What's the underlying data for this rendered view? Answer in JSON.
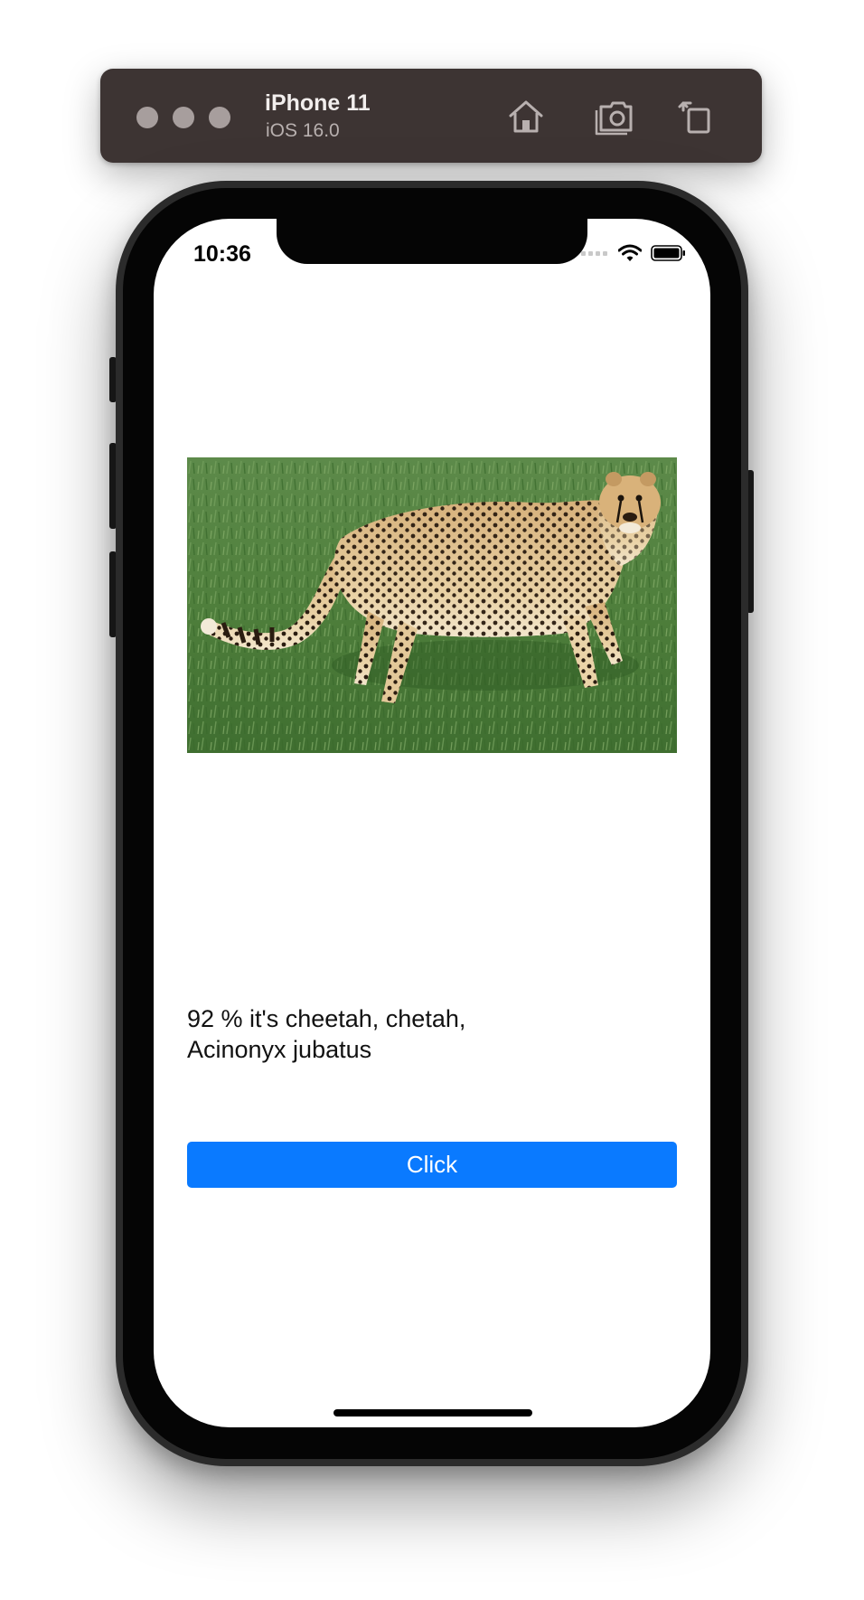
{
  "simulator": {
    "device_name": "iPhone 11",
    "os_version": "iOS 16.0",
    "toolbar_icons": [
      "home-icon",
      "screenshot-icon",
      "rotate-icon"
    ]
  },
  "status_bar": {
    "time": "10:36",
    "icons": [
      "cellular-signal-icon",
      "wifi-icon",
      "battery-icon"
    ]
  },
  "app": {
    "image_subject": "cheetah standing in grass",
    "prediction_line1": "92 % it's cheetah, chetah,",
    "prediction_line2": "Acinonyx jubatus",
    "button_label": "Click"
  },
  "colors": {
    "toolbar_bg": "#3d3433",
    "button_bg": "#0a7aff",
    "button_text": "#ffffff",
    "screen_bg": "#ffffff"
  }
}
